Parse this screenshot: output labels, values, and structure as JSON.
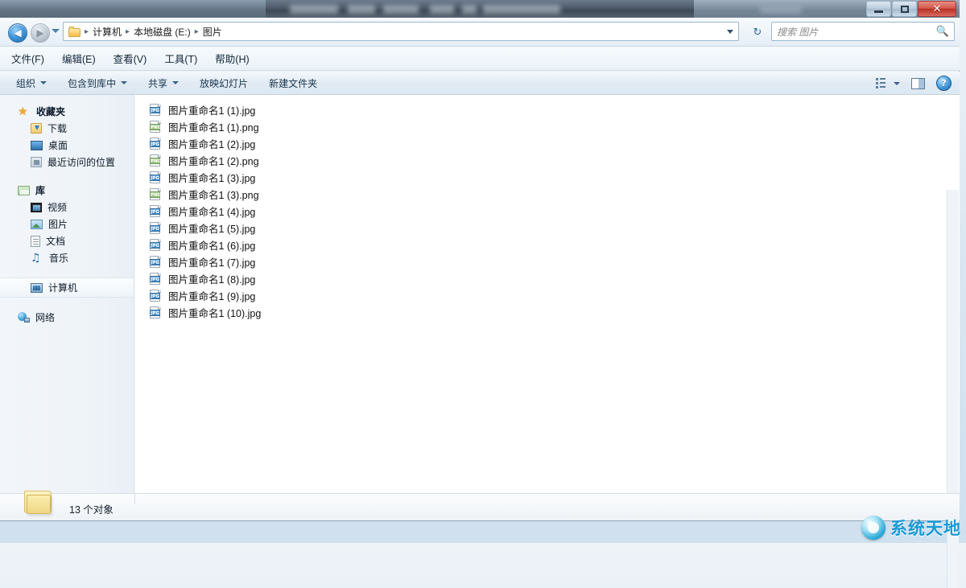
{
  "window": {
    "title_obscured": true,
    "controls": {
      "minimize": "最小化",
      "maximize": "最大化",
      "close": "✕"
    }
  },
  "address_bar": {
    "back_label": "◀",
    "forward_label": "▶",
    "breadcrumb": [
      "计算机",
      "本地磁盘 (E:)",
      "图片"
    ],
    "separator": "▸",
    "refresh_label": "↻"
  },
  "search": {
    "placeholder": "搜索 图片",
    "icon": "search-icon"
  },
  "menu": {
    "items": [
      "文件(F)",
      "编辑(E)",
      "查看(V)",
      "工具(T)",
      "帮助(H)"
    ]
  },
  "toolbar": {
    "items": [
      {
        "label": "组织",
        "caret": true
      },
      {
        "label": "包含到库中",
        "caret": true
      },
      {
        "label": "共享",
        "caret": true
      },
      {
        "label": "放映幻灯片",
        "caret": false
      },
      {
        "label": "新建文件夹",
        "caret": false
      }
    ],
    "help_label": "?"
  },
  "sidebar": {
    "groups": [
      {
        "head": {
          "label": "收藏夹",
          "icon": "star-icon"
        },
        "items": [
          {
            "label": "下载",
            "icon": "download-icon"
          },
          {
            "label": "桌面",
            "icon": "desktop-icon"
          },
          {
            "label": "最近访问的位置",
            "icon": "recent-icon"
          }
        ]
      },
      {
        "head": {
          "label": "库",
          "icon": "library-icon"
        },
        "items": [
          {
            "label": "视频",
            "icon": "video-icon"
          },
          {
            "label": "图片",
            "icon": "picture-icon"
          },
          {
            "label": "文档",
            "icon": "document-icon"
          },
          {
            "label": "音乐",
            "icon": "music-icon"
          }
        ]
      },
      {
        "head": null,
        "items": [
          {
            "label": "计算机",
            "icon": "computer-icon",
            "selected": true
          }
        ]
      },
      {
        "head": null,
        "items": [
          {
            "label": "网络",
            "icon": "network-icon"
          }
        ]
      }
    ]
  },
  "files": [
    {
      "name": "图片重命名1 (1).jpg",
      "type": "JPG"
    },
    {
      "name": "图片重命名1 (1).png",
      "type": "PNG"
    },
    {
      "name": "图片重命名1 (2).jpg",
      "type": "JPG"
    },
    {
      "name": "图片重命名1 (2).png",
      "type": "PNG"
    },
    {
      "name": "图片重命名1 (3).jpg",
      "type": "JPG"
    },
    {
      "name": "图片重命名1 (3).png",
      "type": "PNG"
    },
    {
      "name": "图片重命名1 (4).jpg",
      "type": "JPG"
    },
    {
      "name": "图片重命名1 (5).jpg",
      "type": "JPG"
    },
    {
      "name": "图片重命名1 (6).jpg",
      "type": "JPG"
    },
    {
      "name": "图片重命名1 (7).jpg",
      "type": "JPG"
    },
    {
      "name": "图片重命名1 (8).jpg",
      "type": "JPG"
    },
    {
      "name": "图片重命名1 (9).jpg",
      "type": "JPG"
    },
    {
      "name": "图片重命名1 (10).jpg",
      "type": "JPG"
    }
  ],
  "status_bar": {
    "count_text": "13 个对象"
  },
  "watermark": {
    "text": "系统天地"
  },
  "colors": {
    "accent": "#2f6fae",
    "close_button": "#b93226",
    "jpg_badge": "#3b84c4",
    "png_badge": "#8fbd72",
    "watermark": "#1b9ad4"
  }
}
